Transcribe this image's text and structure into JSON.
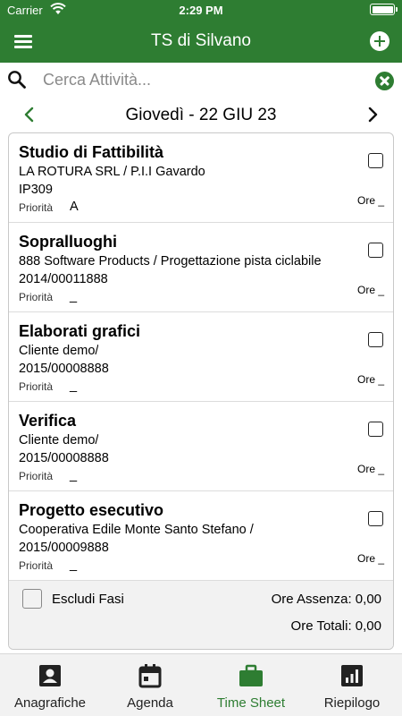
{
  "status_bar": {
    "carrier": "Carrier",
    "time": "2:29 PM"
  },
  "header": {
    "title": "TS di Silvano",
    "menu_icon": "menu-icon",
    "add_icon": "add-circle-icon"
  },
  "search": {
    "placeholder": "Cerca Attività...",
    "value": ""
  },
  "date_nav": {
    "date": "Giovedì - 22 GIU 23"
  },
  "priority_label": "Priorità",
  "activities": [
    {
      "name": "Studio di Fattibilità",
      "line1": "LA ROTURA SRL / P.I.I Gavardo",
      "line2": "IP309",
      "priority": "A",
      "ore": "Ore _",
      "checked": false
    },
    {
      "name": "Sopralluoghi",
      "line1": "888 Software Products / Progettazione pista ciclabile",
      "line2": "2014/00011888",
      "priority": "_",
      "ore": "Ore _",
      "checked": false
    },
    {
      "name": "Elaborati grafici",
      "line1": "Cliente demo/",
      "line2": "2015/00008888",
      "priority": "_",
      "ore": "Ore _",
      "checked": false
    },
    {
      "name": "Verifica",
      "line1": "Cliente demo/",
      "line2": "2015/00008888",
      "priority": "_",
      "ore": "Ore _",
      "checked": false
    },
    {
      "name": "Progetto esecutivo",
      "line1": "Cooperativa Edile Monte Santo Stefano /",
      "line2": "2015/00009888",
      "priority": "_",
      "ore": "Ore _",
      "checked": false
    }
  ],
  "summary": {
    "escludi_label": "Escludi Fasi",
    "ore_assenza": "Ore Assenza: 0,00",
    "ore_totali": "Ore Totali: 0,00"
  },
  "tabs": [
    {
      "label": "Anagrafiche",
      "icon": "contact-card-icon",
      "active": false
    },
    {
      "label": "Agenda",
      "icon": "calendar-icon",
      "active": false
    },
    {
      "label": "Time Sheet",
      "icon": "briefcase-icon",
      "active": true
    },
    {
      "label": "Riepilogo",
      "icon": "bar-chart-icon",
      "active": false
    }
  ],
  "colors": {
    "primary": "#2e7d32",
    "tab_bar": "#f2f2f2",
    "active_tab": "#2e7d32"
  }
}
